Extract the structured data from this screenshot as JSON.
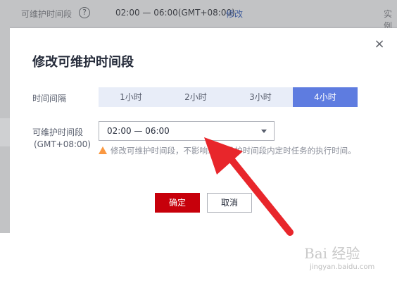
{
  "background": {
    "row_label": "可维护时间段",
    "help_icon": "?",
    "row_value": "02:00 — 06:00(GMT+08:00)",
    "edit_link": "修改",
    "right_text": "实例"
  },
  "dialog": {
    "title": "修改可维护时间段",
    "close_icon": "×",
    "interval_label": "时间间隔",
    "interval_options": [
      "1小时",
      "2小时",
      "3小时",
      "4小时"
    ],
    "interval_selected": "4小时",
    "period_label_line1": "可维护时间段",
    "period_label_line2": "(GMT+08:00)",
    "period_value": "02:00 — 06:00",
    "warning_text": "修改可维护时间段，不影响… 可维护时间段内定时任务的执行时间。",
    "confirm_label": "确定",
    "cancel_label": "取消"
  },
  "colors": {
    "accent": "#5e7ce0",
    "primary_button": "#c7000b",
    "warning": "#fa9841",
    "annotation_arrow": "#e8262b"
  },
  "watermark": {
    "brand": "Bai 经验",
    "site": "jingyan.baidu.com"
  }
}
